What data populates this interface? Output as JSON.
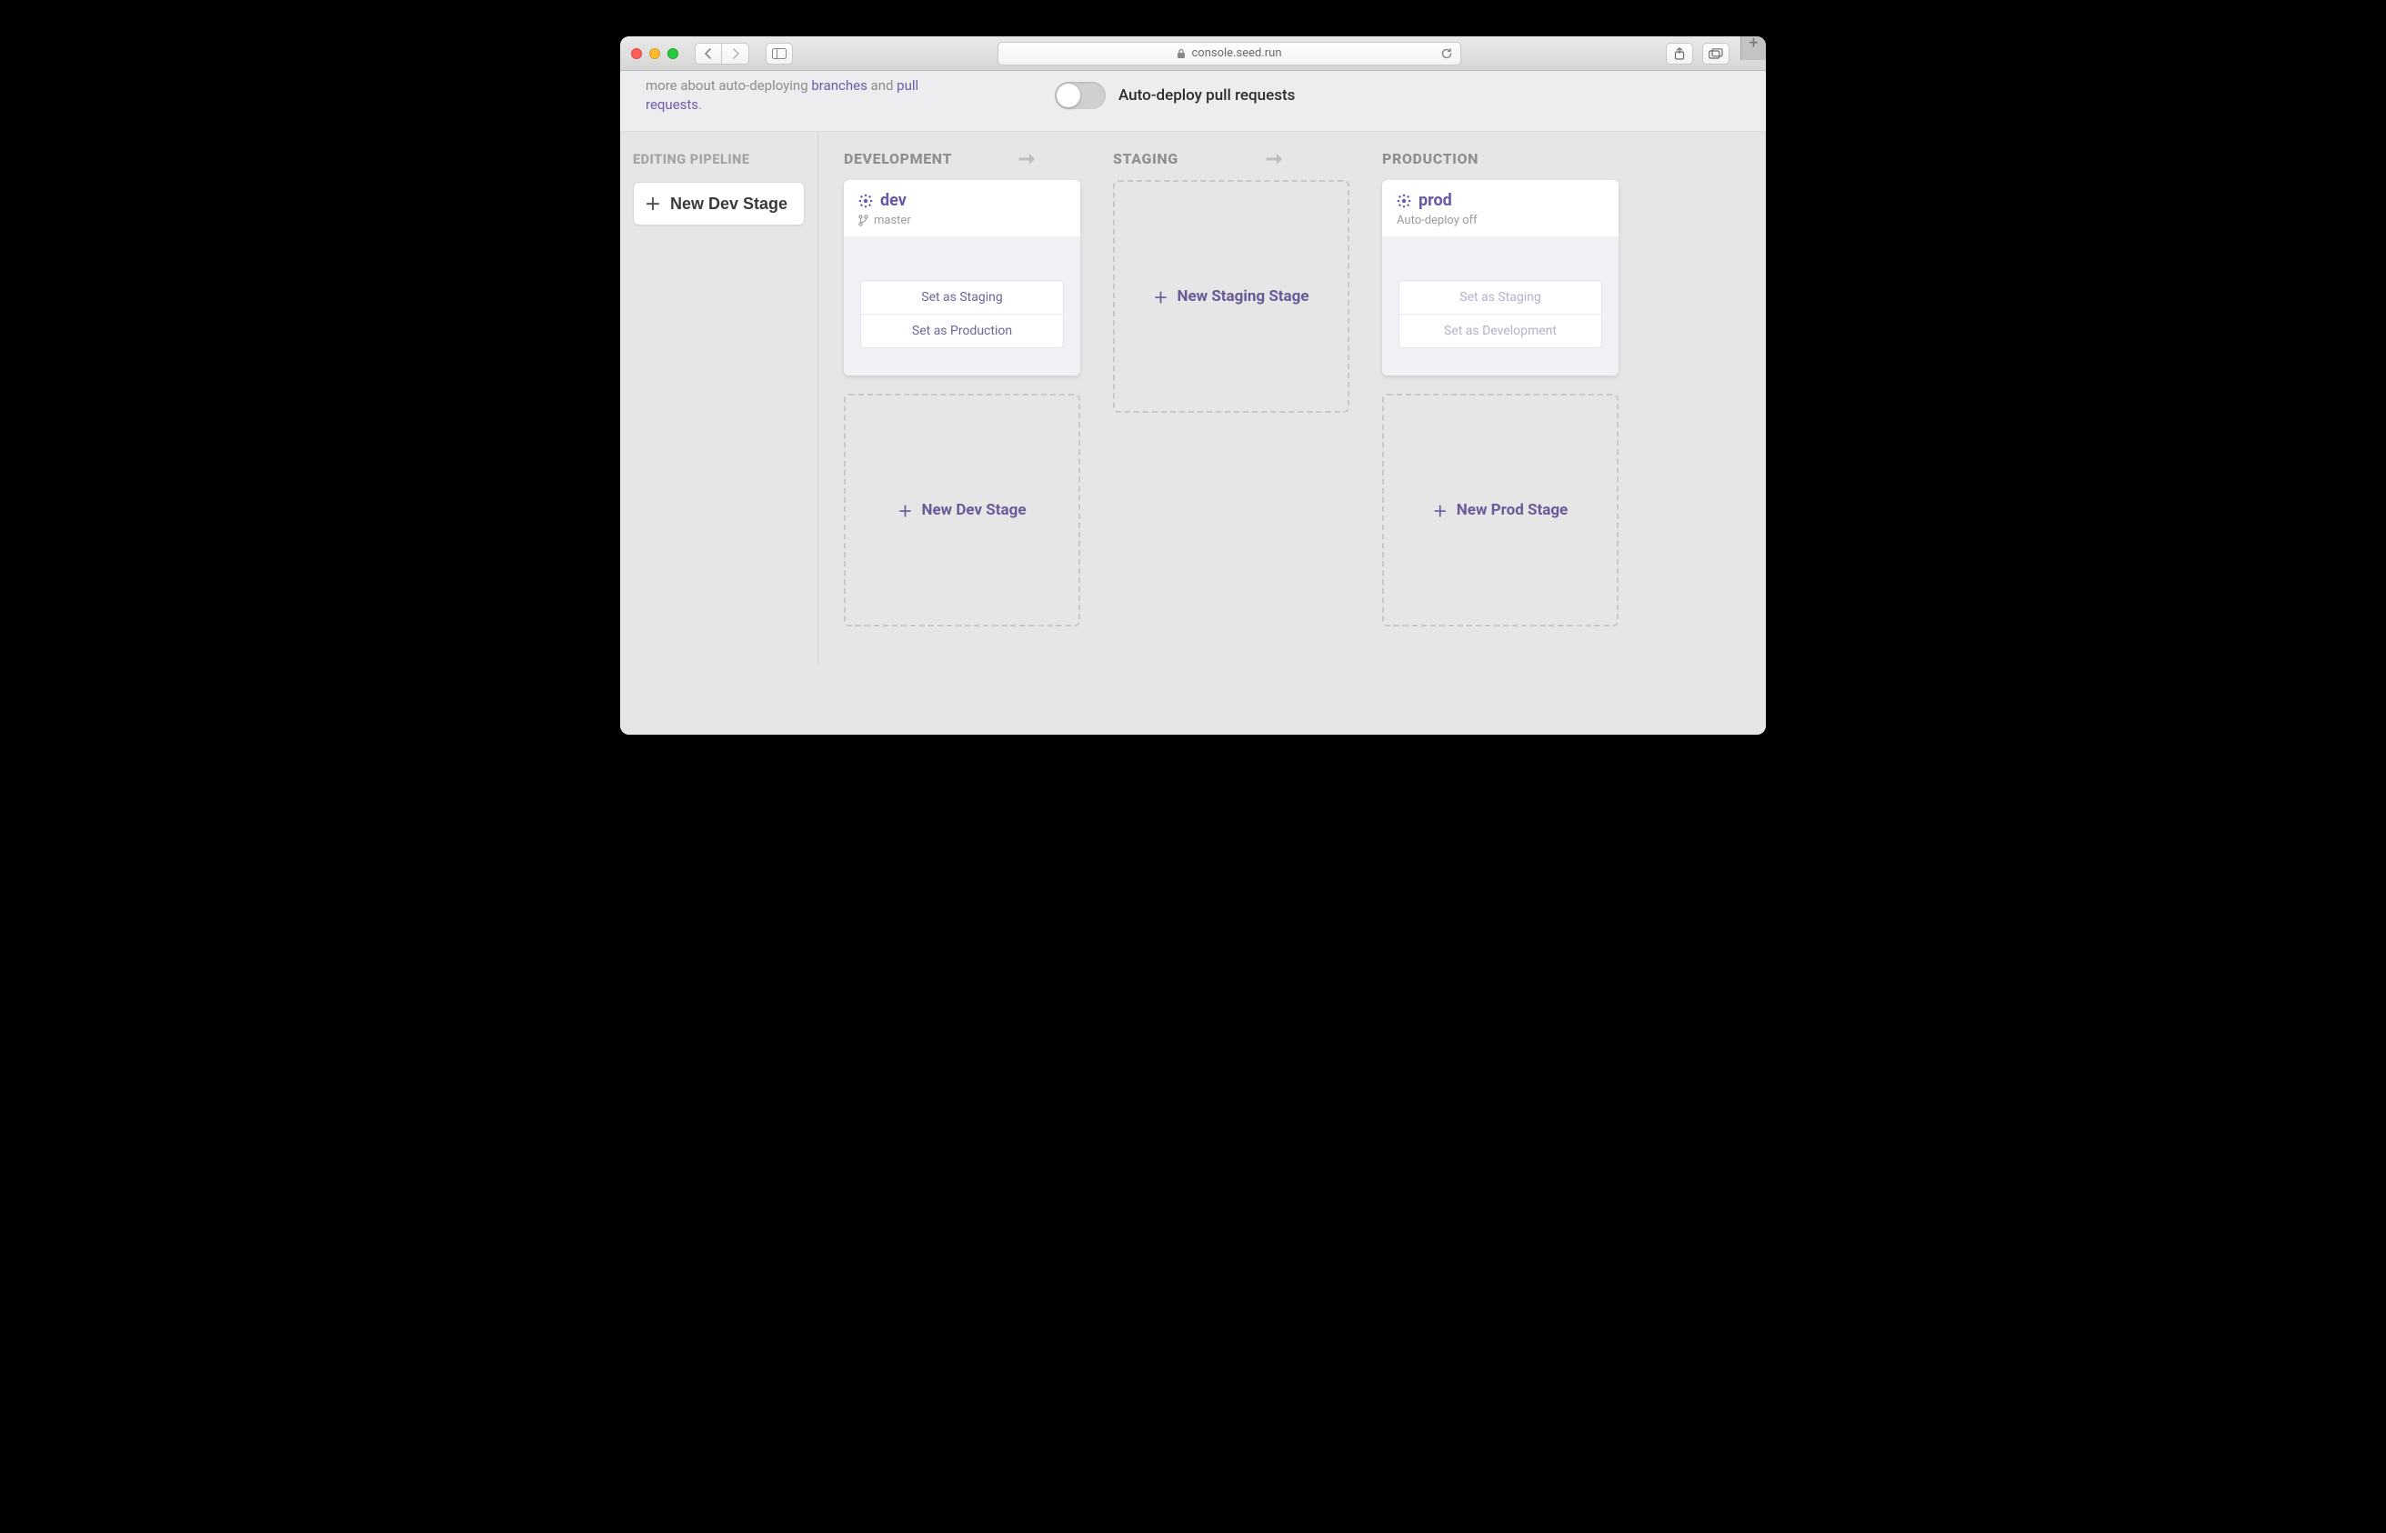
{
  "browser": {
    "url_host": "console.seed.run"
  },
  "topPanel": {
    "text_prefix": "more about auto-deploying ",
    "link_branches": "branches",
    "text_and": " and ",
    "link_prs": "pull requests",
    "text_suffix": ".",
    "toggle_label": "Auto-deploy pull requests",
    "toggle_on": false
  },
  "sidebar": {
    "title": "EDITING PIPELINE",
    "new_dev_label": "New Dev Stage"
  },
  "columns": {
    "development": {
      "title": "DEVELOPMENT",
      "stage": {
        "name": "dev",
        "branch": "master",
        "actions": [
          "Set as Staging",
          "Set as Production"
        ]
      },
      "new_label": "New Dev Stage"
    },
    "staging": {
      "title": "STAGING",
      "new_label": "New Staging Stage"
    },
    "production": {
      "title": "PRODUCTION",
      "stage": {
        "name": "prod",
        "sub": "Auto-deploy off",
        "actions": [
          "Set as Staging",
          "Set as Development"
        ]
      },
      "new_label": "New Prod Stage"
    }
  }
}
